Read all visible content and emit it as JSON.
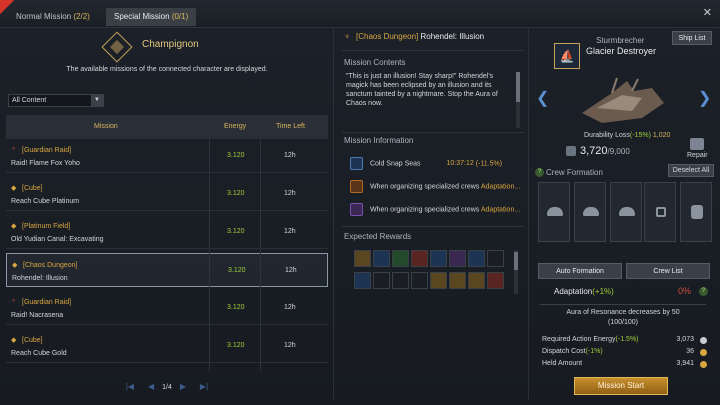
{
  "tabs": [
    {
      "label": "Normal Mission",
      "count": "(2/2)"
    },
    {
      "label": "Special Mission",
      "count": "(0/1)"
    }
  ],
  "close_icon": "close-icon",
  "left": {
    "character_name": "Champignon",
    "subtitle": "The available missions of the connected character are displayed.",
    "filter_value": "All Content",
    "headers": {
      "mission": "Mission",
      "energy": "Energy",
      "time": "Time Left"
    },
    "missions": [
      {
        "category": "[Guardian Raid]",
        "name": "Raid! Flame Fox Yoho",
        "energy": "3.120",
        "time": "12h",
        "icon": "guardian-icon",
        "icon_color": "red"
      },
      {
        "category": "[Cube]",
        "name": "Reach Cube Platinum",
        "energy": "3.120",
        "time": "12h",
        "icon": "cube-icon",
        "icon_color": "gold"
      },
      {
        "category": "[Platinum Field]",
        "name": "Old Yudian Canal: Excavating",
        "energy": "3.120",
        "time": "12h",
        "icon": "field-icon",
        "icon_color": "gold"
      },
      {
        "category": "[Chaos Dungeon]",
        "name": "Rohendel: Illusion",
        "energy": "3.120",
        "time": "12h",
        "icon": "chaos-icon",
        "icon_color": "gold",
        "selected": true
      },
      {
        "category": "[Guardian Raid]",
        "name": "Raid! Nacrasena",
        "energy": "3.120",
        "time": "12h",
        "icon": "guardian-icon",
        "icon_color": "red"
      },
      {
        "category": "[Cube]",
        "name": "Reach Cube Gold",
        "energy": "3.120",
        "time": "12h",
        "icon": "cube-icon",
        "icon_color": "gold"
      }
    ],
    "pager": {
      "text": "1/4"
    }
  },
  "middle": {
    "title_category": "[Chaos Dungeon]",
    "title_name": "Rohendel: Illusion",
    "contents_header": "Mission Contents",
    "contents_text": "\"This is just an illusion! Stay sharp!\" Rohendel's magick has been eclipsed by an illusion and its sanctum tainted by a nightmare. Stop the Aura of Chaos now.",
    "info_header": "Mission Information",
    "info_rows": [
      {
        "label": "Cold Snap Seas",
        "value_time": "10:37:12",
        "value_mod": "(-11.5%)"
      },
      {
        "label": "When organizing specialized crews",
        "highlight": "Adaptation..."
      },
      {
        "label": "When organizing specialized crews",
        "highlight": "Adaptation..."
      }
    ],
    "rewards_header": "Expected Rewards"
  },
  "right": {
    "ship_type": "Sturmbrecher",
    "ship_list_label": "Ship List",
    "ship_name": "Glacier Destroyer",
    "durability_label": "Durability Loss",
    "durability_mod": "(-15%)",
    "durability_loss": "1,020",
    "durability_current": "3,720",
    "durability_max": "/9,000",
    "repair_label": "Repair",
    "crew_header": "Crew Formation",
    "deselect_label": "Deselect All",
    "auto_formation_label": "Auto Formation",
    "crew_list_label": "Crew List",
    "adaptation_label": "Adaptation",
    "adaptation_mod": "(+1%)",
    "adaptation_value": "0%",
    "resonance_line1": "Aura of Resonance decreases by 50",
    "resonance_line2": "(100/100)",
    "stats": [
      {
        "label": "Required Action Energy",
        "mod": "(-1.5%)",
        "value": "3,073"
      },
      {
        "label": "Dispatch Cost",
        "mod": "(-1%)",
        "value": "36"
      },
      {
        "label": "Held Amount",
        "mod": "",
        "value": "3,941"
      }
    ],
    "start_label": "Mission Start"
  }
}
